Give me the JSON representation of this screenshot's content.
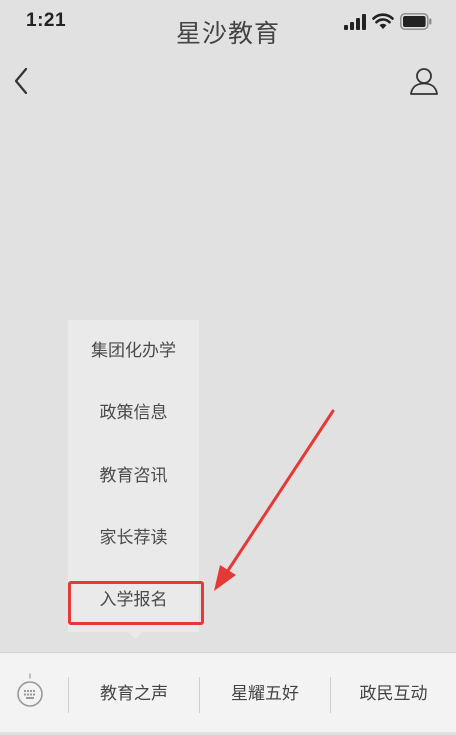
{
  "status_bar": {
    "time": "1:21"
  },
  "nav": {
    "title": "星沙教育"
  },
  "popup_menu": {
    "items": [
      {
        "label": "集团化办学"
      },
      {
        "label": "政策信息"
      },
      {
        "label": "教育咨讯"
      },
      {
        "label": "家长荐读"
      },
      {
        "label": "入学报名",
        "highlighted": true
      }
    ]
  },
  "bottom_bar": {
    "tabs": [
      {
        "label": "教育之声",
        "menu_open": true
      },
      {
        "label": "星耀五好"
      },
      {
        "label": "政民互动"
      }
    ]
  },
  "annotation": {
    "highlight_color": "#e53935"
  },
  "icons": {
    "status": [
      "signal-icon",
      "wifi-icon",
      "battery-icon"
    ],
    "nav": [
      "back-icon",
      "profile-icon"
    ],
    "bottom": [
      "keyboard-icon"
    ]
  }
}
